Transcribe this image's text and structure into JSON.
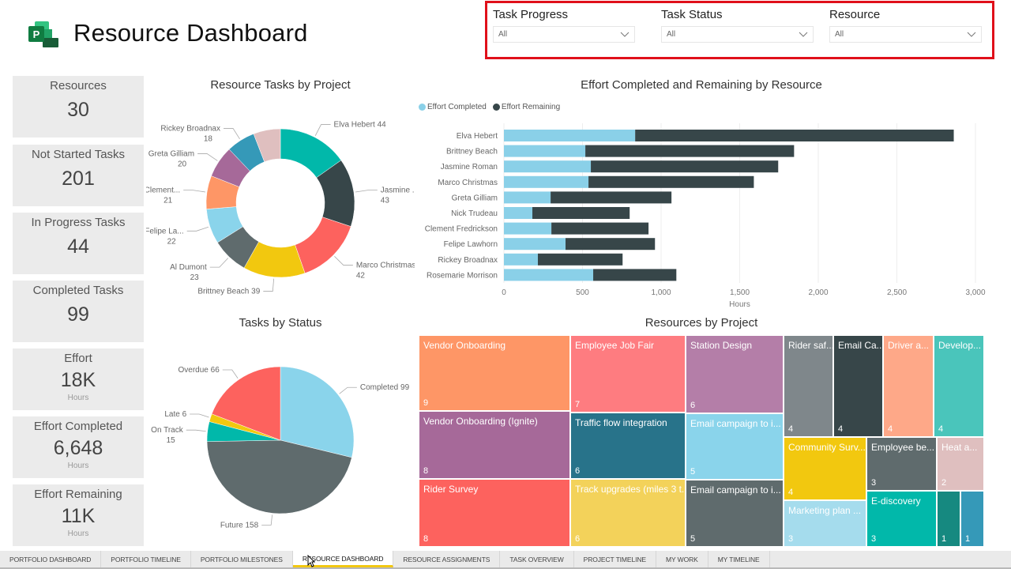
{
  "header": {
    "title": "Resource Dashboard",
    "logo_icon": "ms-project-logo-icon",
    "logo_letter": "P"
  },
  "filters": [
    {
      "label": "Task Progress",
      "value": "All"
    },
    {
      "label": "Task Status",
      "value": "All"
    },
    {
      "label": "Resource",
      "value": "All"
    }
  ],
  "kpis": [
    {
      "label": "Resources",
      "value": "30",
      "unit": ""
    },
    {
      "label": "Not Started Tasks",
      "value": "201",
      "unit": ""
    },
    {
      "label": "In Progress Tasks",
      "value": "44",
      "unit": ""
    },
    {
      "label": "Completed Tasks",
      "value": "99",
      "unit": ""
    },
    {
      "label": "Effort",
      "value": "18K",
      "unit": "Hours"
    },
    {
      "label": "Effort Completed",
      "value": "6,648",
      "unit": "Hours"
    },
    {
      "label": "Effort Remaining",
      "value": "11K",
      "unit": "Hours"
    }
  ],
  "colors": {
    "completed": "#8ad0e8",
    "remaining": "#374649",
    "filter_highlight": "#e0101a",
    "active_tab_accent": "#f2c811"
  },
  "chart_data": [
    {
      "type": "pie",
      "variant": "donut",
      "title": "Resource Tasks by Project",
      "slices": [
        {
          "label": "Elva Hebert",
          "display": "Elva Hebert 44",
          "value": 44,
          "color": "#01b8aa"
        },
        {
          "label": "Jasmine ...",
          "display": "Jasmine ...",
          "display2": "43",
          "value": 43,
          "color": "#374649"
        },
        {
          "label": "Marco Christmas",
          "display": "Marco Christmas",
          "display2": "42",
          "value": 42,
          "color": "#fd625e"
        },
        {
          "label": "Brittney Beach",
          "display": "Brittney Beach 39",
          "value": 39,
          "color": "#f2c80f"
        },
        {
          "label": "Al Dumont",
          "display": "Al Dumont",
          "display2": "23",
          "value": 23,
          "color": "#5f6b6d"
        },
        {
          "label": "Felipe La...",
          "display": "Felipe La...",
          "display2": "22",
          "value": 22,
          "color": "#8ad4eb"
        },
        {
          "label": "Clement...",
          "display": "Clement...",
          "display2": "21",
          "value": 21,
          "color": "#fe9666"
        },
        {
          "label": "Greta Gilliam",
          "display": "Greta Gilliam",
          "display2": "20",
          "value": 20,
          "color": "#a66999"
        },
        {
          "label": "Rickey Broadnax",
          "display": "Rickey Broadnax",
          "display2": "18",
          "value": 18,
          "color": "#3599b8"
        },
        {
          "label": "",
          "display": "",
          "value": 17,
          "color": "#dfbfbf"
        }
      ],
      "legend": "none"
    },
    {
      "type": "bar",
      "orientation": "horizontal",
      "stacked": true,
      "title": "Effort Completed and Remaining by Resource",
      "categories": [
        "Elva Hebert",
        "Brittney Beach",
        "Jasmine Roman",
        "Marco Christmas",
        "Greta Gilliam",
        "Nick Trudeau",
        "Clement Fredrickson",
        "Felipe Lawhorn",
        "Rickey Broadnax",
        "Rosemarie Morrison"
      ],
      "series": [
        {
          "name": "Effort Completed",
          "color": "#8ad0e8",
          "values": [
            835,
            518,
            553,
            538,
            297,
            181,
            302,
            392,
            216,
            568
          ]
        },
        {
          "name": "Effort Remaining",
          "color": "#374649",
          "values": [
            2027,
            1328,
            1192,
            1052,
            769,
            619,
            618,
            569,
            539,
            529
          ]
        }
      ],
      "xlabel": "Hours",
      "ylabel": "",
      "xlim": [
        0,
        3000
      ],
      "xticks": [
        0,
        500,
        1000,
        1500,
        2000,
        2500,
        3000
      ],
      "xtick_labels": [
        "0",
        "500",
        "1,000",
        "1,500",
        "2,000",
        "2,500",
        "3,000"
      ],
      "grid": true,
      "legend": "top-left"
    },
    {
      "type": "pie",
      "title": "Tasks by Status",
      "slices": [
        {
          "label": "Completed",
          "display": "Completed 99",
          "value": 99,
          "color": "#8ad4eb"
        },
        {
          "label": "Future",
          "display": "Future 158",
          "value": 158,
          "color": "#5f6b6d"
        },
        {
          "label": "On Track",
          "display": "On Track",
          "display2": "15",
          "value": 15,
          "color": "#01b8aa"
        },
        {
          "label": "Late",
          "display": "Late 6",
          "value": 6,
          "color": "#f2c80f"
        },
        {
          "label": "Overdue",
          "display": "Overdue 66",
          "value": 66,
          "color": "#fd625e"
        }
      ],
      "legend": "none"
    },
    {
      "type": "treemap",
      "title": "Resources by Project",
      "tiles": [
        {
          "label": "Vendor Onboarding",
          "value": 9,
          "color": "#fe9666"
        },
        {
          "label": "Vendor Onboarding (Ignite)",
          "value": 8,
          "color": "#a66999"
        },
        {
          "label": "Rider Survey",
          "value": 8,
          "color": "#fd625e"
        },
        {
          "label": "Employee Job Fair",
          "value": 7,
          "color": "#fe7c80"
        },
        {
          "label": "Traffic flow integration",
          "value": 6,
          "color": "#28738a"
        },
        {
          "label": "Track upgrades (miles 3 t...",
          "value": 6,
          "color": "#f3d25a"
        },
        {
          "label": "Station Design",
          "value": 6,
          "color": "#b47ea8"
        },
        {
          "label": "Email campaign to i...",
          "value": 5,
          "color": "#8ad4eb"
        },
        {
          "label": "Email campaign to i...",
          "value": 5,
          "color": "#5f6b6d"
        },
        {
          "label": "Rider saf...",
          "value": 4,
          "color": "#7f878b"
        },
        {
          "label": "Email Ca...",
          "value": 4,
          "color": "#374649"
        },
        {
          "label": "Driver a...",
          "value": 4,
          "color": "#fea888"
        },
        {
          "label": "Develop...",
          "value": 4,
          "color": "#4ac5bb"
        },
        {
          "label": "Community Surv...",
          "value": 4,
          "color": "#f2c80f"
        },
        {
          "label": "Marketing plan ...",
          "value": 3,
          "color": "#a5dced"
        },
        {
          "label": "Employee be...",
          "value": 3,
          "color": "#5f6b6d"
        },
        {
          "label": "E-discovery",
          "value": 3,
          "color": "#01b8aa"
        },
        {
          "label": "Heat a...",
          "value": 2,
          "color": "#dfbfbf"
        },
        {
          "label": "",
          "value": 1,
          "color": "#168980"
        },
        {
          "label": "",
          "value": 1,
          "color": "#3599b8"
        }
      ]
    }
  ],
  "tabs": [
    {
      "label": "PORTFOLIO DASHBOARD",
      "active": false
    },
    {
      "label": "PORTFOLIO TIMELINE",
      "active": false
    },
    {
      "label": "PORTFOLIO MILESTONES",
      "active": false
    },
    {
      "label": "RESOURCE DASHBOARD",
      "active": true
    },
    {
      "label": "RESOURCE ASSIGNMENTS",
      "active": false
    },
    {
      "label": "TASK OVERVIEW",
      "active": false
    },
    {
      "label": "PROJECT TIMELINE",
      "active": false
    },
    {
      "label": "MY WORK",
      "active": false
    },
    {
      "label": "MY TIMELINE",
      "active": false
    }
  ]
}
